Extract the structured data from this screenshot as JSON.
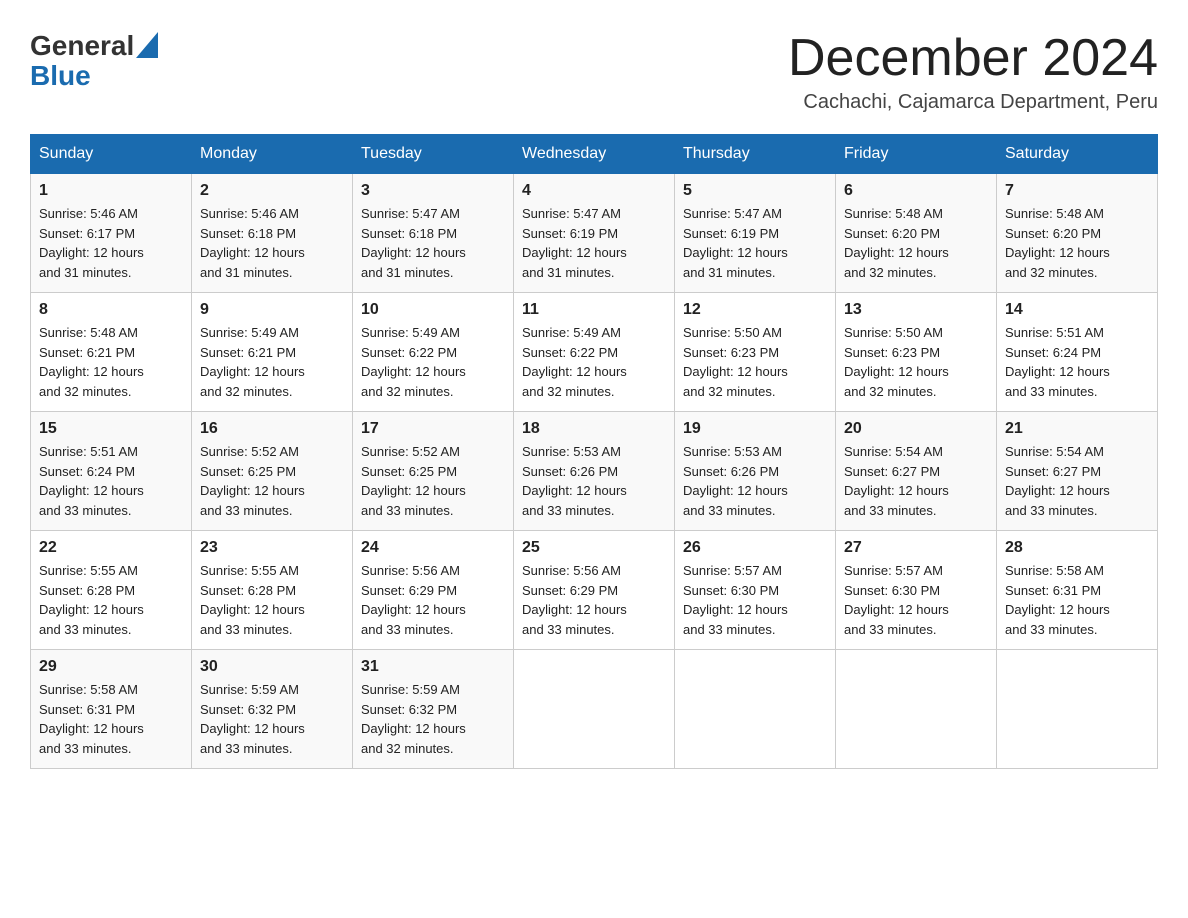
{
  "header": {
    "logo_general": "General",
    "logo_blue": "Blue",
    "title": "December 2024",
    "location": "Cachachi, Cajamarca Department, Peru"
  },
  "calendar": {
    "days_of_week": [
      "Sunday",
      "Monday",
      "Tuesday",
      "Wednesday",
      "Thursday",
      "Friday",
      "Saturday"
    ],
    "weeks": [
      [
        {
          "day": "1",
          "sunrise": "5:46 AM",
          "sunset": "6:17 PM",
          "daylight": "12 hours and 31 minutes."
        },
        {
          "day": "2",
          "sunrise": "5:46 AM",
          "sunset": "6:18 PM",
          "daylight": "12 hours and 31 minutes."
        },
        {
          "day": "3",
          "sunrise": "5:47 AM",
          "sunset": "6:18 PM",
          "daylight": "12 hours and 31 minutes."
        },
        {
          "day": "4",
          "sunrise": "5:47 AM",
          "sunset": "6:19 PM",
          "daylight": "12 hours and 31 minutes."
        },
        {
          "day": "5",
          "sunrise": "5:47 AM",
          "sunset": "6:19 PM",
          "daylight": "12 hours and 31 minutes."
        },
        {
          "day": "6",
          "sunrise": "5:48 AM",
          "sunset": "6:20 PM",
          "daylight": "12 hours and 32 minutes."
        },
        {
          "day": "7",
          "sunrise": "5:48 AM",
          "sunset": "6:20 PM",
          "daylight": "12 hours and 32 minutes."
        }
      ],
      [
        {
          "day": "8",
          "sunrise": "5:48 AM",
          "sunset": "6:21 PM",
          "daylight": "12 hours and 32 minutes."
        },
        {
          "day": "9",
          "sunrise": "5:49 AM",
          "sunset": "6:21 PM",
          "daylight": "12 hours and 32 minutes."
        },
        {
          "day": "10",
          "sunrise": "5:49 AM",
          "sunset": "6:22 PM",
          "daylight": "12 hours and 32 minutes."
        },
        {
          "day": "11",
          "sunrise": "5:49 AM",
          "sunset": "6:22 PM",
          "daylight": "12 hours and 32 minutes."
        },
        {
          "day": "12",
          "sunrise": "5:50 AM",
          "sunset": "6:23 PM",
          "daylight": "12 hours and 32 minutes."
        },
        {
          "day": "13",
          "sunrise": "5:50 AM",
          "sunset": "6:23 PM",
          "daylight": "12 hours and 32 minutes."
        },
        {
          "day": "14",
          "sunrise": "5:51 AM",
          "sunset": "6:24 PM",
          "daylight": "12 hours and 33 minutes."
        }
      ],
      [
        {
          "day": "15",
          "sunrise": "5:51 AM",
          "sunset": "6:24 PM",
          "daylight": "12 hours and 33 minutes."
        },
        {
          "day": "16",
          "sunrise": "5:52 AM",
          "sunset": "6:25 PM",
          "daylight": "12 hours and 33 minutes."
        },
        {
          "day": "17",
          "sunrise": "5:52 AM",
          "sunset": "6:25 PM",
          "daylight": "12 hours and 33 minutes."
        },
        {
          "day": "18",
          "sunrise": "5:53 AM",
          "sunset": "6:26 PM",
          "daylight": "12 hours and 33 minutes."
        },
        {
          "day": "19",
          "sunrise": "5:53 AM",
          "sunset": "6:26 PM",
          "daylight": "12 hours and 33 minutes."
        },
        {
          "day": "20",
          "sunrise": "5:54 AM",
          "sunset": "6:27 PM",
          "daylight": "12 hours and 33 minutes."
        },
        {
          "day": "21",
          "sunrise": "5:54 AM",
          "sunset": "6:27 PM",
          "daylight": "12 hours and 33 minutes."
        }
      ],
      [
        {
          "day": "22",
          "sunrise": "5:55 AM",
          "sunset": "6:28 PM",
          "daylight": "12 hours and 33 minutes."
        },
        {
          "day": "23",
          "sunrise": "5:55 AM",
          "sunset": "6:28 PM",
          "daylight": "12 hours and 33 minutes."
        },
        {
          "day": "24",
          "sunrise": "5:56 AM",
          "sunset": "6:29 PM",
          "daylight": "12 hours and 33 minutes."
        },
        {
          "day": "25",
          "sunrise": "5:56 AM",
          "sunset": "6:29 PM",
          "daylight": "12 hours and 33 minutes."
        },
        {
          "day": "26",
          "sunrise": "5:57 AM",
          "sunset": "6:30 PM",
          "daylight": "12 hours and 33 minutes."
        },
        {
          "day": "27",
          "sunrise": "5:57 AM",
          "sunset": "6:30 PM",
          "daylight": "12 hours and 33 minutes."
        },
        {
          "day": "28",
          "sunrise": "5:58 AM",
          "sunset": "6:31 PM",
          "daylight": "12 hours and 33 minutes."
        }
      ],
      [
        {
          "day": "29",
          "sunrise": "5:58 AM",
          "sunset": "6:31 PM",
          "daylight": "12 hours and 33 minutes."
        },
        {
          "day": "30",
          "sunrise": "5:59 AM",
          "sunset": "6:32 PM",
          "daylight": "12 hours and 33 minutes."
        },
        {
          "day": "31",
          "sunrise": "5:59 AM",
          "sunset": "6:32 PM",
          "daylight": "12 hours and 32 minutes."
        },
        null,
        null,
        null,
        null
      ]
    ]
  }
}
